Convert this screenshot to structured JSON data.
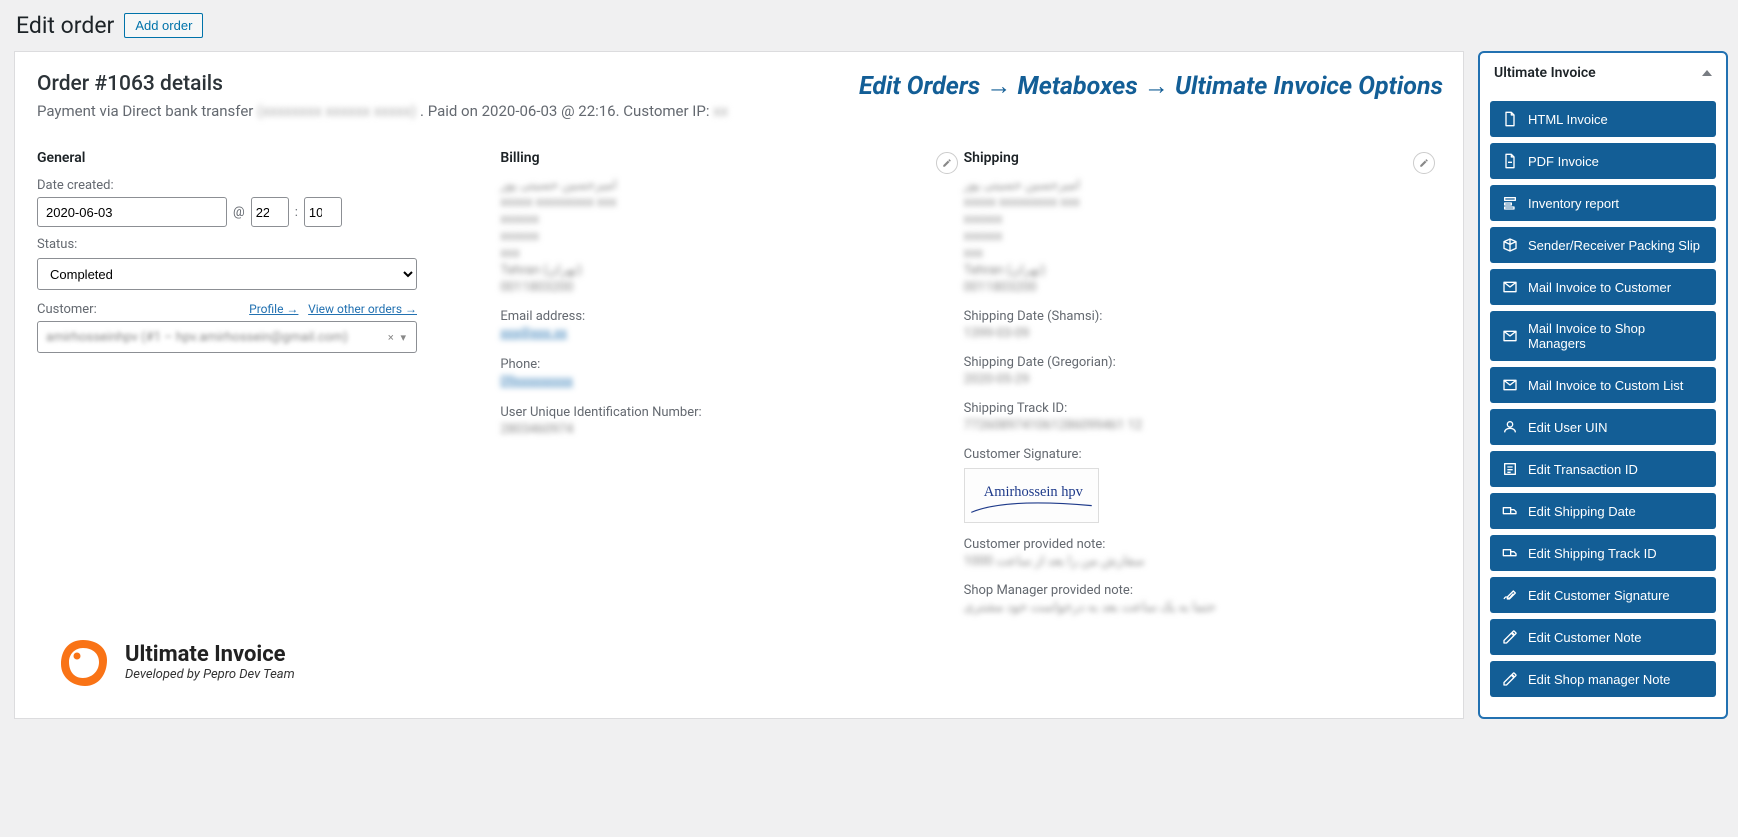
{
  "page": {
    "title": "Edit order",
    "add_btn": "Add order"
  },
  "breadcrumb": "Edit Orders → Metaboxes → Ultimate Invoice Options",
  "order": {
    "title": "Order #1063 details",
    "payment_prefix": "Payment via Direct bank transfer",
    "payment_suffix": ". Paid on 2020-06-03 @ 22:16. Customer IP:"
  },
  "general": {
    "heading": "General",
    "date_label": "Date created:",
    "date_value": "2020-06-03",
    "hour": "22",
    "minute": "10",
    "status_label": "Status:",
    "status_value": "Completed",
    "customer_label": "Customer:",
    "profile_link": "Profile →",
    "view_orders_link": "View other orders →",
    "customer_value": "amirhosseinhpv (#1 – hpv.amirhossein@gmail.com)"
  },
  "billing": {
    "heading": "Billing",
    "email_label": "Email address:",
    "phone_label": "Phone:",
    "uin_label": "User Unique Identification Number:"
  },
  "shipping": {
    "heading": "Shipping",
    "shamsi_label": "Shipping Date (Shamsi):",
    "gregorian_label": "Shipping Date (Gregorian):",
    "track_label": "Shipping Track ID:",
    "signature_label": "Customer Signature:",
    "cust_note_label": "Customer provided note:",
    "mgr_note_label": "Shop Manager provided note:"
  },
  "logo": {
    "title": "Ultimate Invoice",
    "subtitle": "Developed by Pepro Dev Team"
  },
  "side": {
    "title": "Ultimate Invoice",
    "buttons": [
      {
        "icon": "doc",
        "label": "HTML Invoice"
      },
      {
        "icon": "pdf",
        "label": "PDF Invoice"
      },
      {
        "icon": "report",
        "label": "Inventory report"
      },
      {
        "icon": "box",
        "label": "Sender/Receiver Packing Slip"
      },
      {
        "icon": "mail",
        "label": "Mail Invoice to Customer"
      },
      {
        "icon": "mail",
        "label": "Mail Invoice to Shop Managers"
      },
      {
        "icon": "mail",
        "label": "Mail Invoice to Custom List"
      },
      {
        "icon": "user",
        "label": "Edit User UIN"
      },
      {
        "icon": "txn",
        "label": "Edit Transaction ID"
      },
      {
        "icon": "truck",
        "label": "Edit Shipping Date"
      },
      {
        "icon": "truck",
        "label": "Edit Shipping Track ID"
      },
      {
        "icon": "sig",
        "label": "Edit Customer Signature"
      },
      {
        "icon": "pen",
        "label": "Edit Customer Note"
      },
      {
        "icon": "pen",
        "label": "Edit Shop manager Note"
      }
    ]
  }
}
